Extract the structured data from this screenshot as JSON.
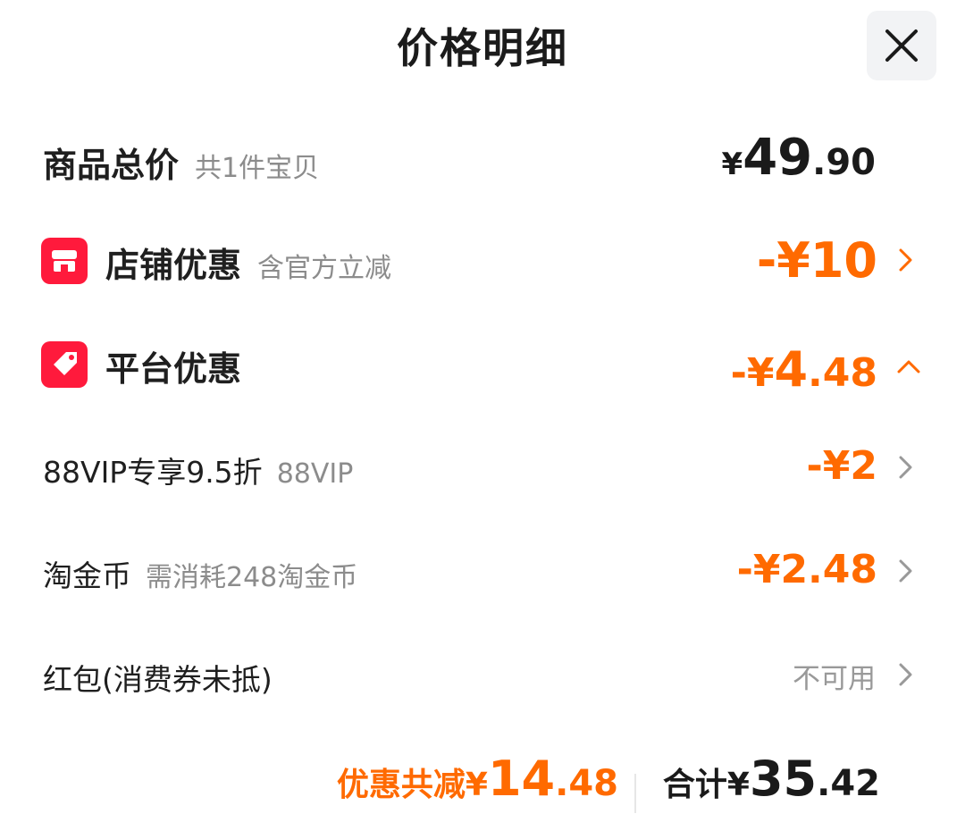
{
  "header": {
    "title": "价格明细"
  },
  "items_total": {
    "label": "商品总价",
    "sub": "共1件宝贝",
    "currency": "¥",
    "integer": "49",
    "decimal": ".90"
  },
  "shop_discount": {
    "icon": "store-icon",
    "label": "店铺优惠",
    "sub": "含官方立减",
    "amount": "-¥10"
  },
  "platform_discount": {
    "icon": "tag-icon",
    "label": "平台优惠",
    "amount_prefix": "-¥",
    "amount_integer": "4",
    "amount_decimal": ".48"
  },
  "details": [
    {
      "label": "88VIP专享9.5折",
      "sub": "88VIP",
      "amount": "-¥2"
    },
    {
      "label": "淘金币",
      "sub": "需消耗248淘金币",
      "amount": "-¥2.48"
    },
    {
      "label": "红包(消费券未抵)",
      "sub": "",
      "amount": "不可用"
    }
  ],
  "footer": {
    "saved_label": "优惠共减",
    "saved_currency": "¥",
    "saved_integer": "14",
    "saved_decimal": ".48",
    "total_label": "合计",
    "total_currency": "¥",
    "total_integer": "35",
    "total_decimal": ".42"
  },
  "colors": {
    "accent": "#ff6a00",
    "badge": "#ff1a3c",
    "muted": "#8c8c8c"
  }
}
